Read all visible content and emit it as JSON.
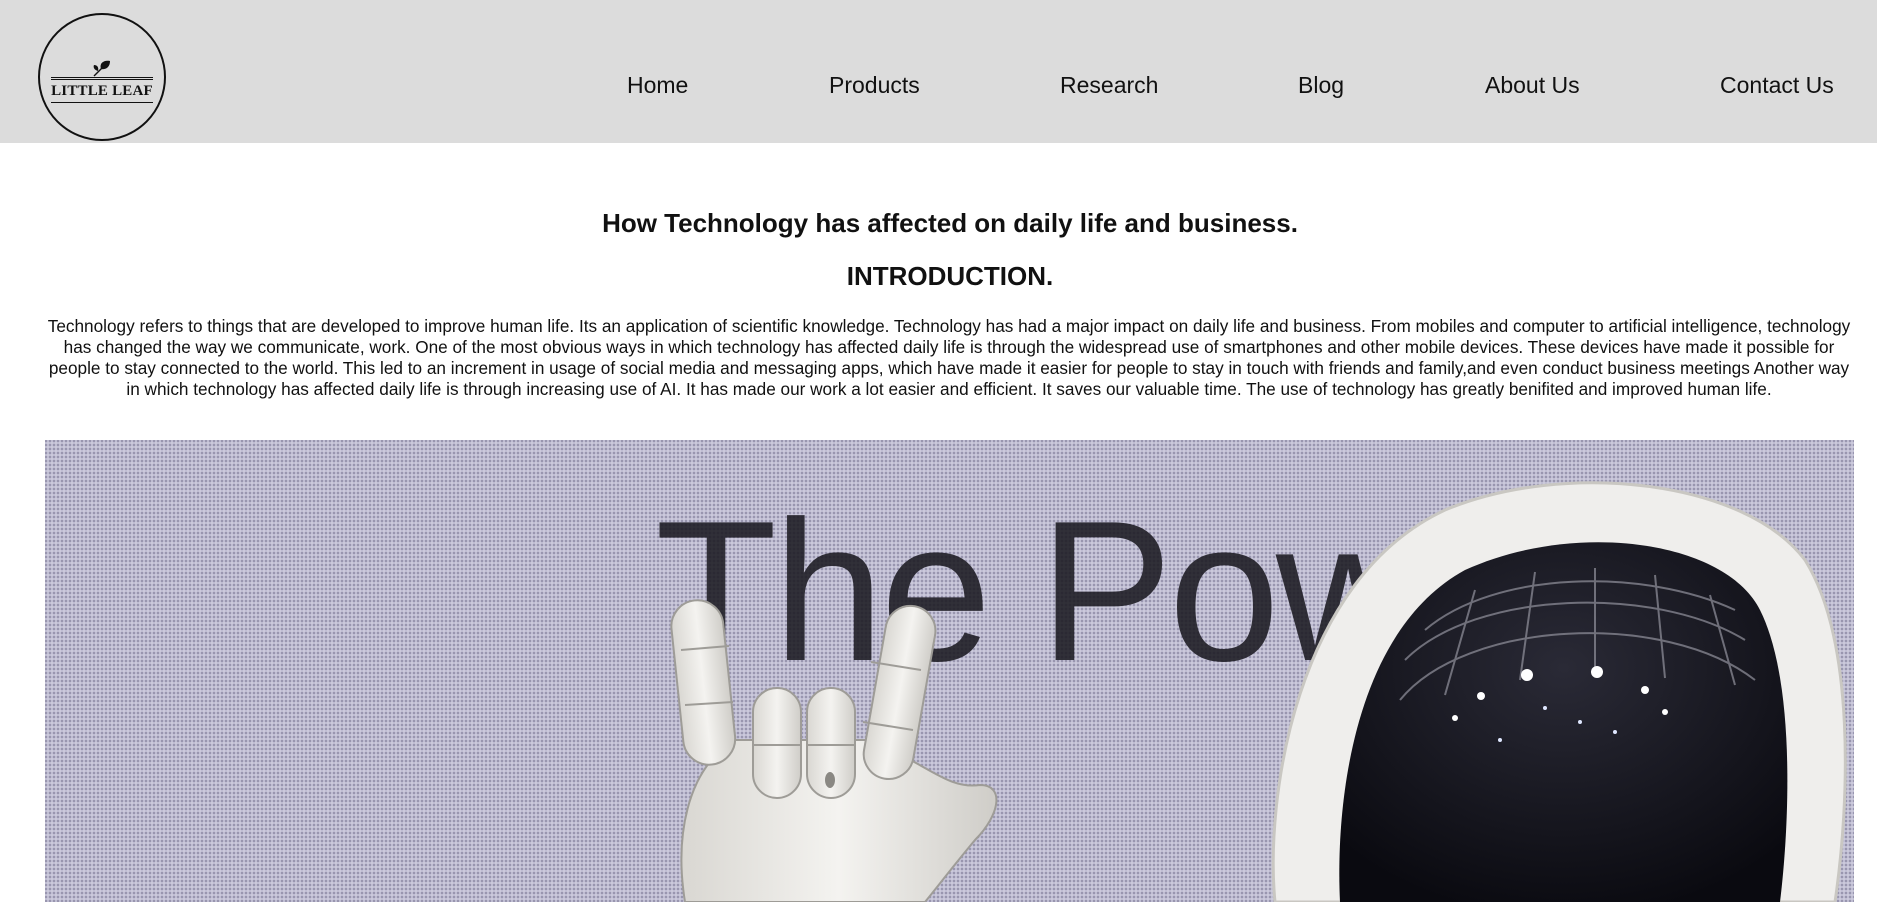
{
  "header": {
    "logo": {
      "text": "LITTLE LEAF",
      "icon": "leaf-icon"
    },
    "nav": [
      {
        "label": "Home"
      },
      {
        "label": "Products"
      },
      {
        "label": "Research"
      },
      {
        "label": "Blog"
      },
      {
        "label": "About Us"
      },
      {
        "label": "Contact Us"
      }
    ]
  },
  "article": {
    "title": "How Technology has affected on daily life and business.",
    "subtitle": "INTRODUCTION.",
    "body": "Technology refers to things that are developed to improve human life. Its an application of scientific knowledge. Technology has had a major impact on daily life and business. From mobiles and computer to artificial intelligence, technology has changed the way we communicate, work. One of the most obvious ways in which technology has affected daily life is through the widespread use of smartphones and other mobile devices. These devices have made it possible for people to stay connected to the world. This led to an increment in usage of social media and messaging apps, which have made it easier for people to stay in touch with friends and family,and even conduct business meetings Another way in which technology has affected daily life is through increasing use of AI. It has made our work a lot easier and efficient. It saves our valuable time. The use of technology has greatly benifited and improved human life."
  },
  "hero_image": {
    "screen_text": "The Powe",
    "colors": {
      "screen": "#b9b6cc",
      "robot": "#efeeec",
      "visor": "#0e0e14"
    }
  }
}
